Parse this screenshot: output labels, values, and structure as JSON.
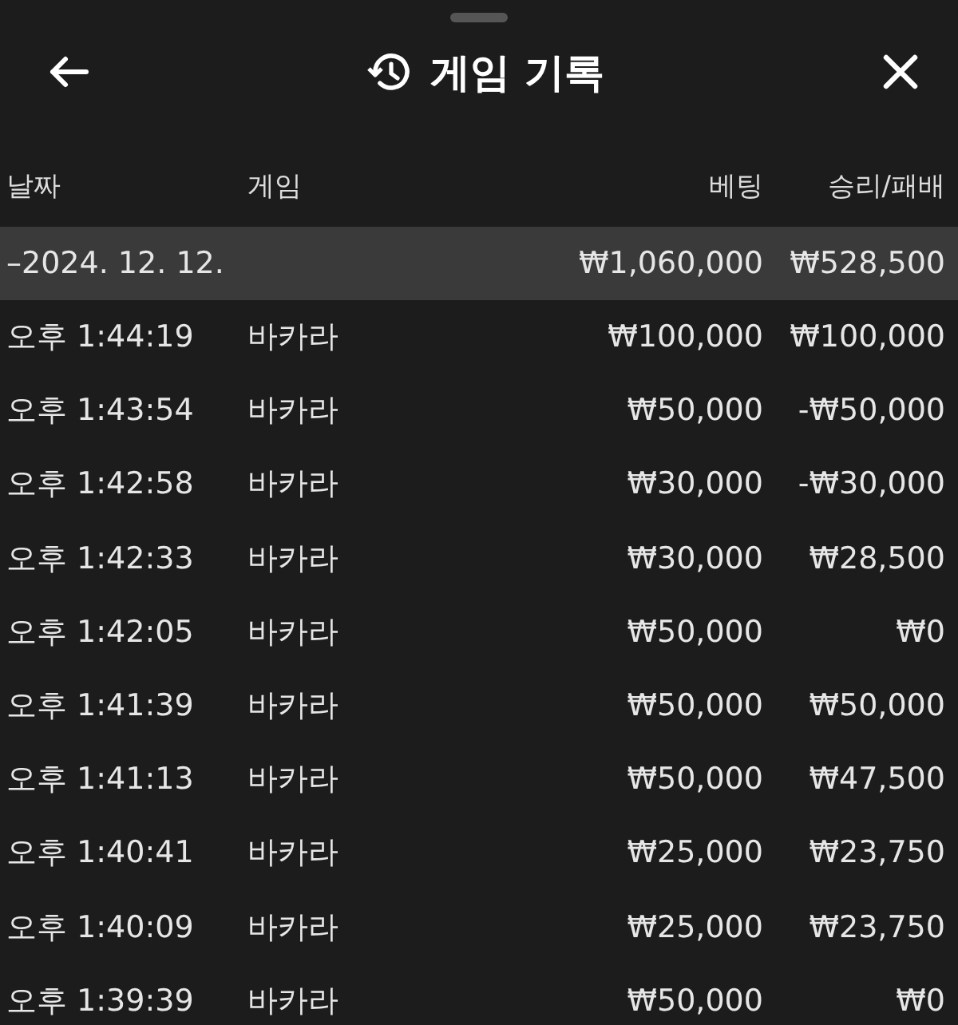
{
  "header": {
    "title": "게임 기록"
  },
  "table": {
    "columns": [
      "날짜",
      "게임",
      "베팅",
      "승리/패배"
    ],
    "group": {
      "date": "–2024. 12. 12.",
      "bet": "₩1,060,000",
      "result": "₩528,500"
    },
    "rows": [
      {
        "time": "오후 1:44:19",
        "game": "바카라",
        "bet": "₩100,000",
        "result": "₩100,000"
      },
      {
        "time": "오후 1:43:54",
        "game": "바카라",
        "bet": "₩50,000",
        "result": "-₩50,000"
      },
      {
        "time": "오후 1:42:58",
        "game": "바카라",
        "bet": "₩30,000",
        "result": "-₩30,000"
      },
      {
        "time": "오후 1:42:33",
        "game": "바카라",
        "bet": "₩30,000",
        "result": "₩28,500"
      },
      {
        "time": "오후 1:42:05",
        "game": "바카라",
        "bet": "₩50,000",
        "result": "₩0"
      },
      {
        "time": "오후 1:41:39",
        "game": "바카라",
        "bet": "₩50,000",
        "result": "₩50,000"
      },
      {
        "time": "오후 1:41:13",
        "game": "바카라",
        "bet": "₩50,000",
        "result": "₩47,500"
      },
      {
        "time": "오후 1:40:41",
        "game": "바카라",
        "bet": "₩25,000",
        "result": "₩23,750"
      },
      {
        "time": "오후 1:40:09",
        "game": "바카라",
        "bet": "₩25,000",
        "result": "₩23,750"
      },
      {
        "time": "오후 1:39:39",
        "game": "바카라",
        "bet": "₩50,000",
        "result": "₩0"
      }
    ]
  }
}
